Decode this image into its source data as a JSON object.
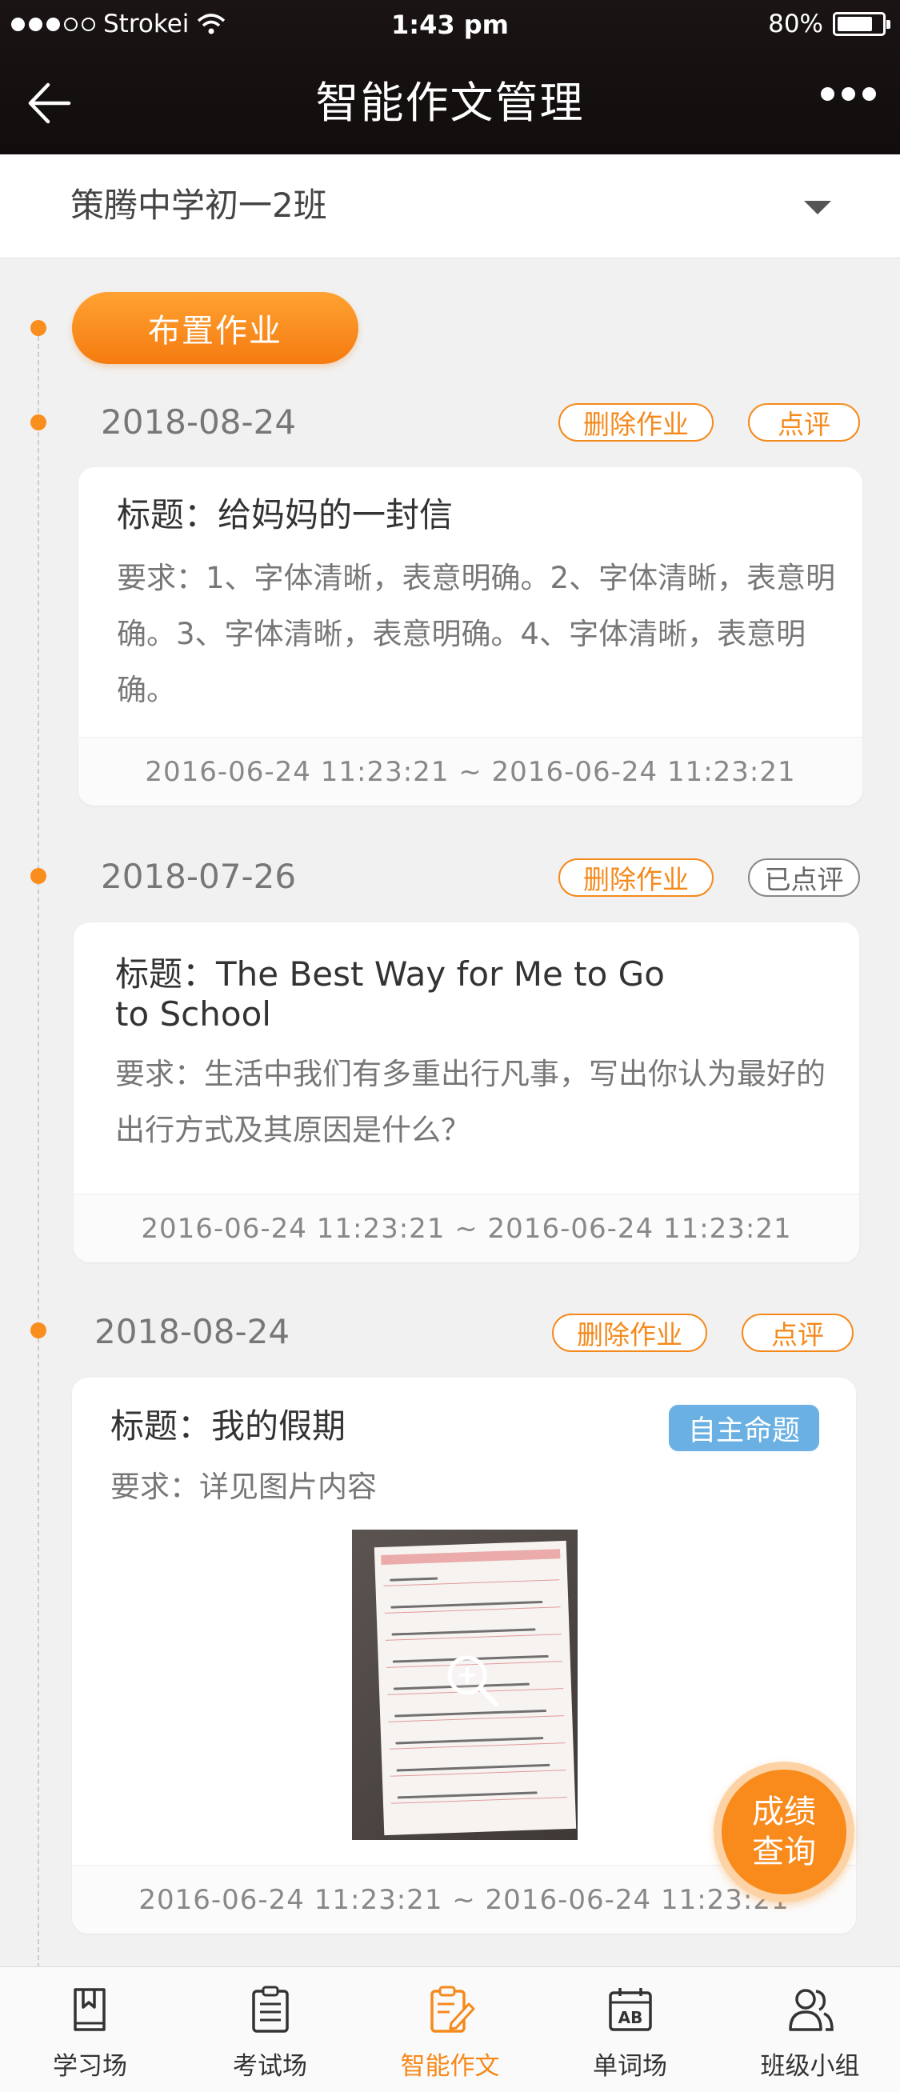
{
  "status_bar": {
    "carrier": "Strokei",
    "time": "1:43 pm",
    "battery": "80%",
    "battery_level": 0.8
  },
  "nav": {
    "title": "智能作文管理",
    "back_icon": "arrow-left-icon",
    "more_icon": "more-dots-icon"
  },
  "class_selector": {
    "value": "策腾中学初一2班",
    "icon": "caret-down-icon"
  },
  "actions": {
    "assign_label": "布置作业",
    "score_line1": "成绩",
    "score_line2": "查询"
  },
  "entries": [
    {
      "date": "2018-08-24",
      "delete_label": "删除作业",
      "review_label": "点评",
      "title": "标题：给妈妈的一封信",
      "requirement": "要求：1、字体清晰，表意明确。2、字体清晰，表意明确。3、字体清晰，表意明确。4、字体清晰，表意明确。",
      "time_range": "2016-06-24 11:23:21 ~ 2016-06-24 11:23:21"
    },
    {
      "date": "2018-07-26",
      "delete_label": "删除作业",
      "review_label": "已点评",
      "title": "标题：The Best Way for Me to Go to School",
      "requirement": "要求：生活中我们有多重出行凡事，写出你认为最好的出行方式及其原因是什么？",
      "time_range": "2016-06-24 11:23:21 ~ 2016-06-24 11:23:21"
    },
    {
      "date": "2018-08-24",
      "delete_label": "删除作业",
      "review_label": "点评",
      "title": "标题：我的假期",
      "badge": "自主命题",
      "requirement": "要求：详见图片内容",
      "time_range": "2016-06-24 11:23:21 ~ 2016-06-24 11:23:21"
    }
  ],
  "tabs": [
    {
      "label": "学习场",
      "icon": "book-bookmark-icon"
    },
    {
      "label": "考试场",
      "icon": "clipboard-icon"
    },
    {
      "label": "智能作文",
      "icon": "essay-edit-icon",
      "active": true
    },
    {
      "label": "单词场",
      "icon": "calendar-ab-icon"
    },
    {
      "label": "班级小组",
      "icon": "users-icon"
    }
  ],
  "colors": {
    "accent": "#f5891c",
    "header_bg": "#140f0f",
    "badge_blue": "#6ab0e3",
    "page_bg": "#f1f1f1"
  }
}
